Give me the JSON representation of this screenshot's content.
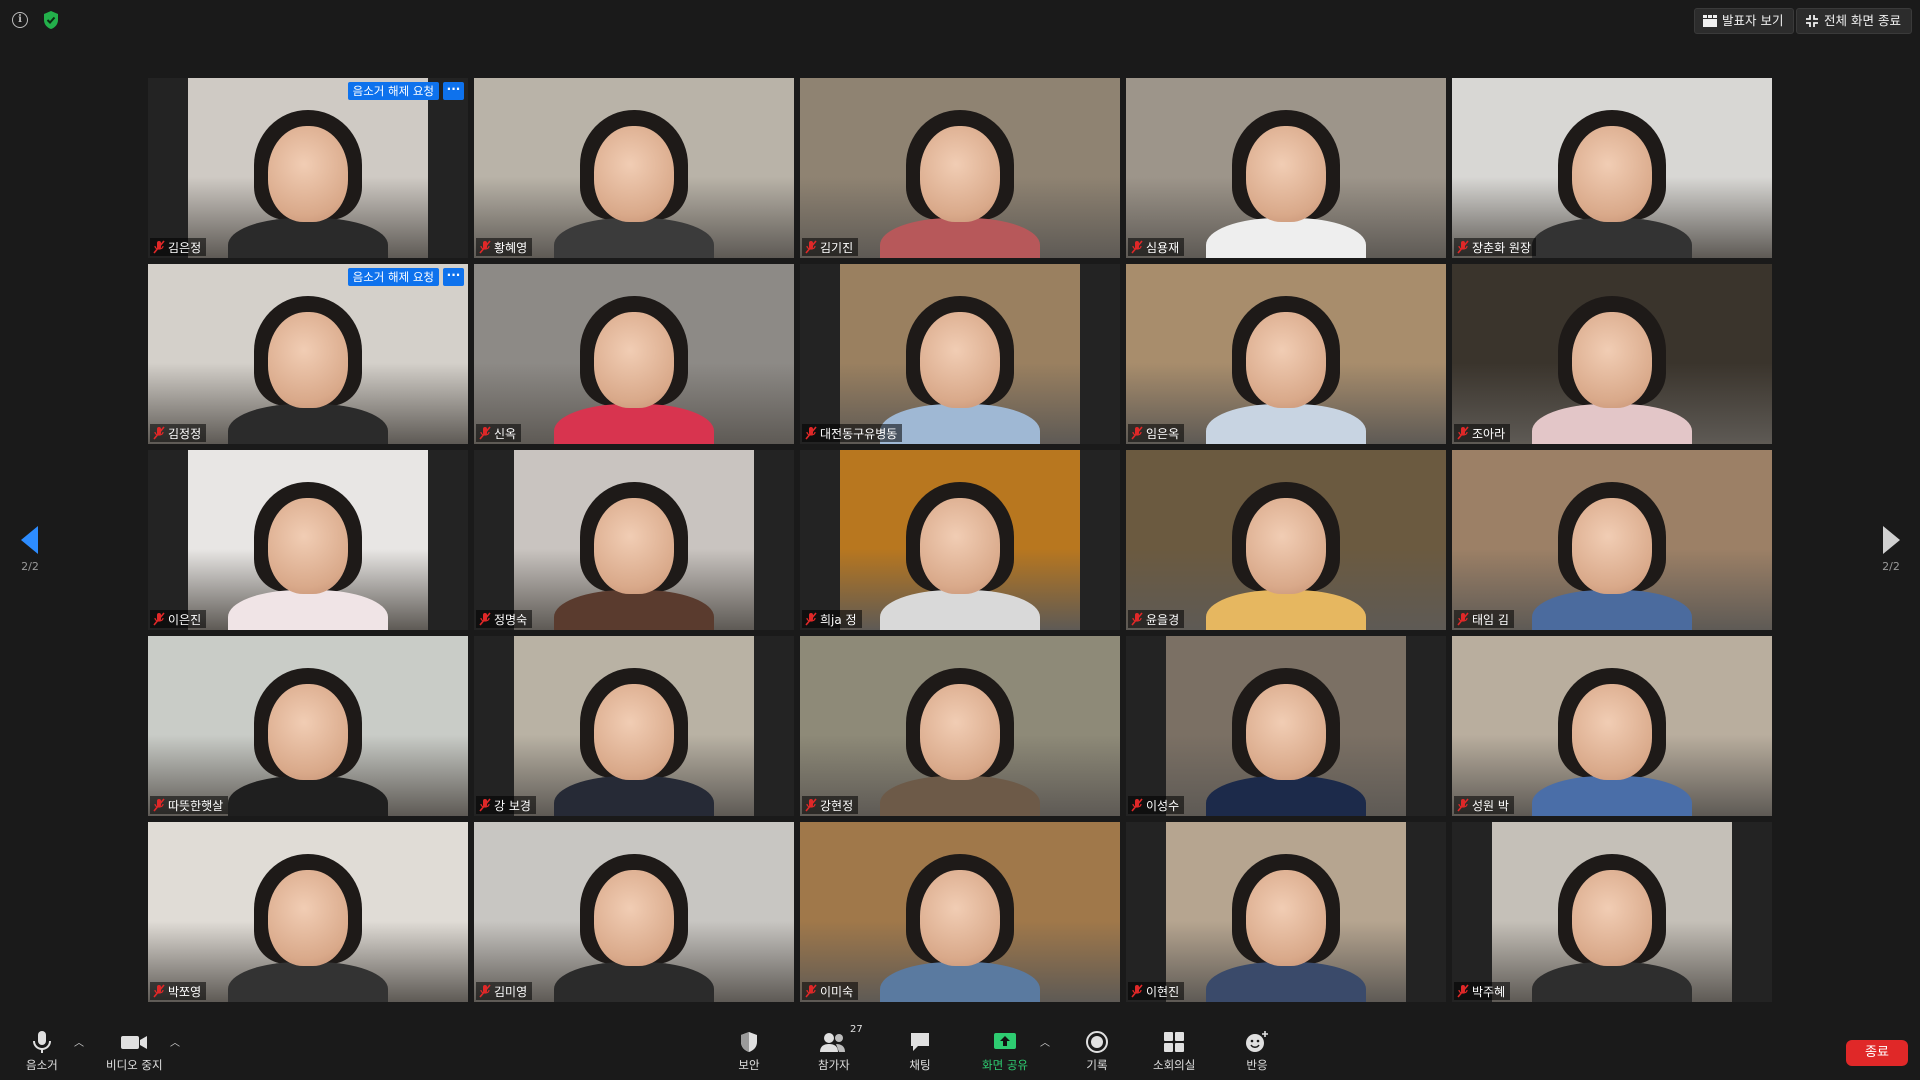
{
  "topbar": {
    "speaker_view_label": "발표자 보기",
    "exit_fullscreen_label": "전체 화면 종료"
  },
  "participants": [
    {
      "name": "김은정",
      "unmute_request": "음소거 해제 요청",
      "more": "···",
      "bg": "#cfcac4",
      "frame": "narrow",
      "shirt": "#2a2a2a"
    },
    {
      "name": "황혜영",
      "bg": "#b9b3a8",
      "frame": "full",
      "shirt": "#3b3b3b"
    },
    {
      "name": "김기진",
      "bg": "#8f8372",
      "frame": "full",
      "shirt": "#b7585a"
    },
    {
      "name": "심용재",
      "bg": "#9d958a",
      "frame": "full",
      "shirt": "#eeeeee"
    },
    {
      "name": "장춘화 원장",
      "bg": "#d8d7d4",
      "frame": "full",
      "shirt": "#333333"
    },
    {
      "name": "김정정",
      "unmute_request": "음소거 해제 요청",
      "more": "···",
      "bg": "#d4d0ca",
      "frame": "full",
      "shirt": "#2b2b2b"
    },
    {
      "name": "신옥",
      "bg": "#8d8a86",
      "frame": "full",
      "shirt": "#d8344f"
    },
    {
      "name": "대전동구유병동",
      "bg": "#9a8060",
      "frame": "narrow",
      "shirt": "#9fb8d4"
    },
    {
      "name": "임은옥",
      "bg": "#a88d6c",
      "frame": "full",
      "shirt": "#c8d4e2"
    },
    {
      "name": "조아라",
      "bg": "#3a342c",
      "frame": "full",
      "shirt": "#e3c6c8"
    },
    {
      "name": "이은진",
      "bg": "#e8e6e4",
      "frame": "narrow",
      "shirt": "#f0e4e6"
    },
    {
      "name": "정명숙",
      "bg": "#c9c4c0",
      "frame": "narrow",
      "shirt": "#5a3b2e"
    },
    {
      "name": "희ja 정",
      "bg": "#b8771f",
      "frame": "narrow",
      "shirt": "#d9d9d9"
    },
    {
      "name": "윤을경",
      "bg": "#6b5a40",
      "frame": "full",
      "shirt": "#e6b760"
    },
    {
      "name": "태임 김",
      "bg": "#9c8066",
      "frame": "full",
      "shirt": "#4b6b9e"
    },
    {
      "name": "따뜻한햇살",
      "bg": "#c9ccc7",
      "frame": "full",
      "shirt": "#1f1f1f"
    },
    {
      "name": "강 보경",
      "bg": "#b9b2a4",
      "frame": "narrow",
      "shirt": "#262a36"
    },
    {
      "name": "강현정",
      "bg": "#8e8a78",
      "frame": "full",
      "shirt": "#6d5a48"
    },
    {
      "name": "이성수",
      "bg": "#7b7064",
      "frame": "narrow",
      "shirt": "#1c2a4a"
    },
    {
      "name": "성원 박",
      "bg": "#b9ae9e",
      "frame": "full",
      "shirt": "#4a6ea8"
    },
    {
      "name": "박쪼영",
      "bg": "#e0dcd6",
      "frame": "full",
      "shirt": "#333333"
    },
    {
      "name": "김미영",
      "bg": "#c8c6c2",
      "frame": "full",
      "shirt": "#2b2b2b"
    },
    {
      "name": "이미숙",
      "bg": "#a0784a",
      "frame": "full",
      "shirt": "#5a7aa0"
    },
    {
      "name": "이현진",
      "bg": "#b6a590",
      "frame": "narrow",
      "shirt": "#3a4a6a"
    },
    {
      "name": "박주혜",
      "bg": "#c5c0b8",
      "frame": "narrow",
      "shirt": "#2e2e2e"
    }
  ],
  "pager": {
    "left": "2/2",
    "right": "2/2"
  },
  "toolbar": {
    "mute_label": "음소거",
    "video_label": "비디오 중지",
    "security_label": "보안",
    "participants_label": "참가자",
    "participants_count": "27",
    "chat_label": "채팅",
    "share_label": "화면 공유",
    "record_label": "기록",
    "breakout_label": "소회의실",
    "reactions_label": "반응",
    "end_label": "종료"
  },
  "colors": {
    "accent_blue": "#0e72ed",
    "share_green": "#2ecc71",
    "end_red": "#e02828"
  }
}
